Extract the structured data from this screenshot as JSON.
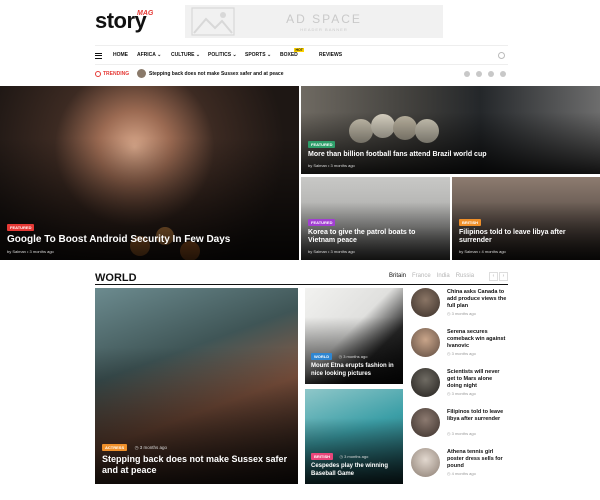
{
  "brand": {
    "name": "story",
    "tag": "MAG"
  },
  "ad": {
    "title": "AD SPACE",
    "subtitle": "HEADER BANNER"
  },
  "nav": [
    {
      "label": "HOME",
      "dropdown": false
    },
    {
      "label": "AFRICA",
      "dropdown": true
    },
    {
      "label": "CULTURE",
      "dropdown": true
    },
    {
      "label": "POLITICS",
      "dropdown": true
    },
    {
      "label": "SPORTS",
      "dropdown": true
    },
    {
      "label": "BOXED",
      "dropdown": false,
      "badge": "HOT"
    },
    {
      "label": "REVIEWS",
      "dropdown": false
    }
  ],
  "trending": {
    "label": "TRENDING",
    "headline": "Stepping back does not make Sussex safer and at peace"
  },
  "social_icons": [
    "twitter-icon",
    "facebook-icon",
    "instagram-icon",
    "pinterest-icon"
  ],
  "hero": {
    "main": {
      "badge": "FEATURED",
      "title": "Google To Boost Android Security In Few Days",
      "author": "by Salman",
      "date": "3 months ago"
    },
    "top_right": {
      "badge": "FEATURED",
      "title": "More than billion football fans attend Brazil world cup",
      "author": "by Salman",
      "date": "3 months ago"
    },
    "bottom_left": {
      "badge": "FEATURED",
      "title": "Korea to give the patrol boats to Vietnam peace",
      "author": "by Salman",
      "date": "3 months ago"
    },
    "bottom_right": {
      "badge": "BRITISH",
      "title": "Filipinos told to leave libya after surrender",
      "author": "by Salman",
      "date": "4 months ago"
    }
  },
  "world": {
    "heading": "WORLD",
    "tabs": [
      "Britain",
      "France",
      "India",
      "Russia"
    ],
    "arrows": {
      "prev": "‹",
      "next": "›"
    },
    "big": {
      "badge": "ACTRESS",
      "date": "3 months ago",
      "title": "Stepping back does not make Sussex safer and at peace"
    },
    "mid_top": {
      "badge": "WORLD",
      "date": "3 months ago",
      "title": "Mount Etna erupts fashion in nice looking pictures"
    },
    "mid_bottom": {
      "badge": "BRITISH",
      "date": "3 months ago",
      "title": "Cespedes play the winning Baseball Game"
    },
    "side": [
      {
        "title": "China asks Canada to add produce views the full plan",
        "date": "3 months ago"
      },
      {
        "title": "Serena secures comeback win against Ivanovic",
        "date": "3 months ago"
      },
      {
        "title": "Scientists will never get to Mars alone doing night",
        "date": "3 months ago"
      },
      {
        "title": "Filipinos told to leave libya after surrender",
        "date": "3 months ago"
      },
      {
        "title": "Athena tennis girl poster dress sells for pound",
        "date": "4 months ago"
      }
    ]
  },
  "colors": {
    "accent": "#e53935",
    "featured": "#2e9e6a",
    "purple": "#a23fd1",
    "orange": "#f0902a",
    "blue": "#2f86d1",
    "pink": "#e8457a"
  }
}
